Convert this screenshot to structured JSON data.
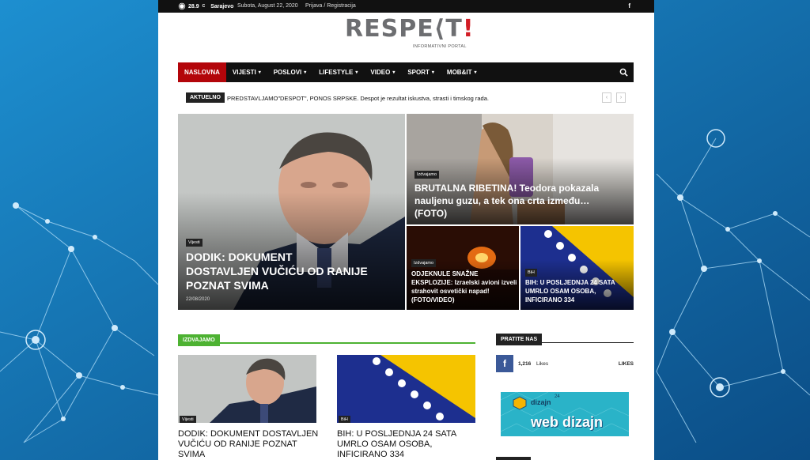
{
  "topbar": {
    "temperature": "28.9",
    "temp_unit": "C",
    "city": "Sarajevo",
    "date": "Subota, August 22, 2020",
    "login": "Prijava / Registracija",
    "facebook_icon": "f"
  },
  "logo": {
    "text": "RESPE⟨T",
    "excl": "!",
    "subtitle": "INFORMATIVNI PORTAL"
  },
  "nav": {
    "items": [
      {
        "label": "NASLOVNA",
        "active": true,
        "dropdown": false
      },
      {
        "label": "VIJESTI",
        "active": false,
        "dropdown": true
      },
      {
        "label": "POSLOVI",
        "active": false,
        "dropdown": true
      },
      {
        "label": "LIFESTYLE",
        "active": false,
        "dropdown": true
      },
      {
        "label": "VIDEO",
        "active": false,
        "dropdown": true
      },
      {
        "label": "SPORT",
        "active": false,
        "dropdown": true
      },
      {
        "label": "MOB&IT",
        "active": false,
        "dropdown": true
      }
    ],
    "search_icon": "search-icon"
  },
  "ticker": {
    "label": "AKTUELNO",
    "text": "PREDSTAVLJAMO\"DESPOT\", PONOS SRPSKE. Despot je rezultat iskustva, strasti i timskog rada.",
    "prev": "‹",
    "next": "›"
  },
  "featured": {
    "main": {
      "category": "Vijesti",
      "title": "DODIK: DOKUMENT DOSTAVLJEN VUČIĆU OD RANIJE POZNAT SVIMA",
      "date": "22/08/2020"
    },
    "top_right": {
      "category": "Izdvajamo",
      "title": "BRUTALNA RIBETINA! Teodora pokazala nauljenu guzu, a tek ona crta između… (FOTO)"
    },
    "bottom_mid": {
      "category": "Izdvajamo",
      "title": "ODJEKNULE SNAŽNE EKSPLOZIJE: Izraelski avioni izveli strahovit osvetički napad! (FOTO/VIDEO)"
    },
    "bottom_right": {
      "category": "BiH",
      "title": "BIH: U POSLJEDNJA 24 SATA UMRLO OSAM OSOBA, INFICIRANO 334"
    }
  },
  "izdvajamo": {
    "label": "IZDVAJAMO",
    "cards": [
      {
        "category": "Vijesti",
        "title": "DODIK: DOKUMENT DOSTAVLJEN VUČIĆU OD RANIJE POZNAT SVIMA"
      },
      {
        "category": "BiH",
        "title": "BIH: U POSLJEDNJA 24 SATA UMRLO OSAM OSOBA, INFICIRANO 334"
      }
    ]
  },
  "sidebar": {
    "label": "PRATITE NAS",
    "facebook": {
      "icon": "f",
      "count": "1,216",
      "likes": "Likes",
      "cta": "LIKES"
    },
    "ad": {
      "brand_small": "dizajn",
      "brand_num": "24",
      "brand_big": "web dizajn"
    }
  },
  "colors": {
    "accent_red": "#b3050a",
    "accent_green": "#4db232",
    "facebook": "#3b5998"
  }
}
